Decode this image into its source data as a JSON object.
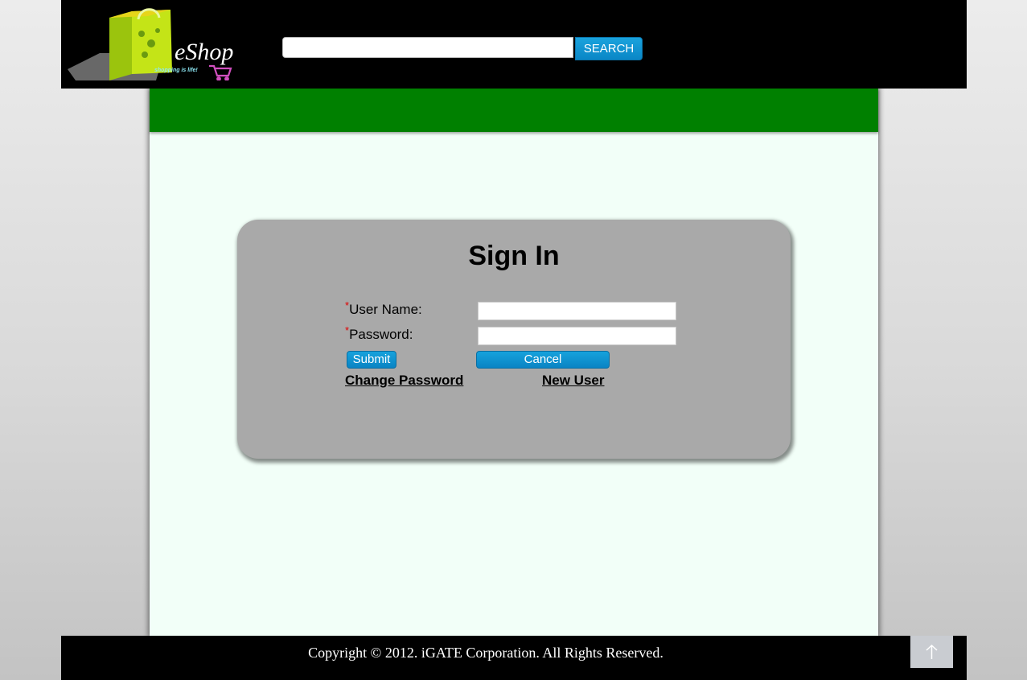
{
  "header": {
    "logo": {
      "brand": "eShop",
      "tagline": "shopping is life!"
    },
    "search": {
      "value": "",
      "placeholder": "",
      "button_label": "SEARCH"
    }
  },
  "signin": {
    "title": "Sign In",
    "required_marker": "*",
    "username_label": "User Name:",
    "username_value": "",
    "password_label": "Password:",
    "password_value": "",
    "submit_label": "Submit",
    "cancel_label": "Cancel",
    "change_password_label": "Change Password",
    "new_user_label": "New User"
  },
  "footer": {
    "copyright": "Copyright © 2012. iGATE Corporation. All Rights Reserved.",
    "to_top_icon": "arrow-up-icon"
  },
  "colors": {
    "header_bg": "#000000",
    "green_bar": "#008000",
    "content_bg": "#f2fff8",
    "signin_box": "#a9a9a9",
    "button_blue": "#0a86c6",
    "required_red": "#e00000"
  }
}
